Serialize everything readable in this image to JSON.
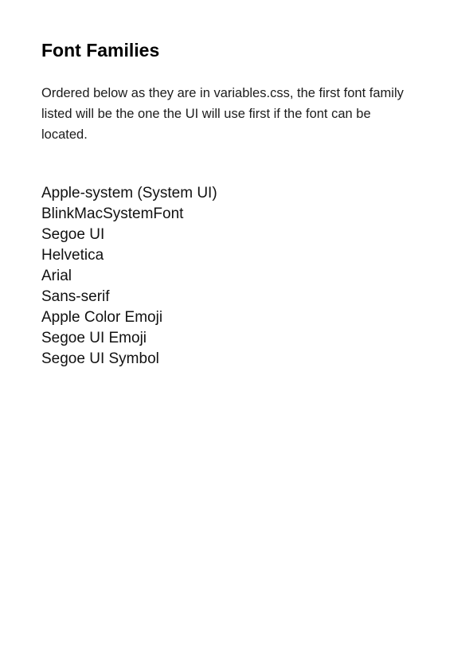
{
  "document": {
    "title": "Font Families",
    "intro": "Ordered below as they are in variables.css, the first font family listed will be the one the UI will use first if the font can be located.",
    "font_families": [
      "Apple-system (System UI)",
      "BlinkMacSystemFont",
      "Segoe UI",
      "Helvetica",
      "Arial",
      "Sans-serif",
      "Apple Color Emoji",
      "Segoe UI Emoji",
      "Segoe UI Symbol"
    ]
  }
}
